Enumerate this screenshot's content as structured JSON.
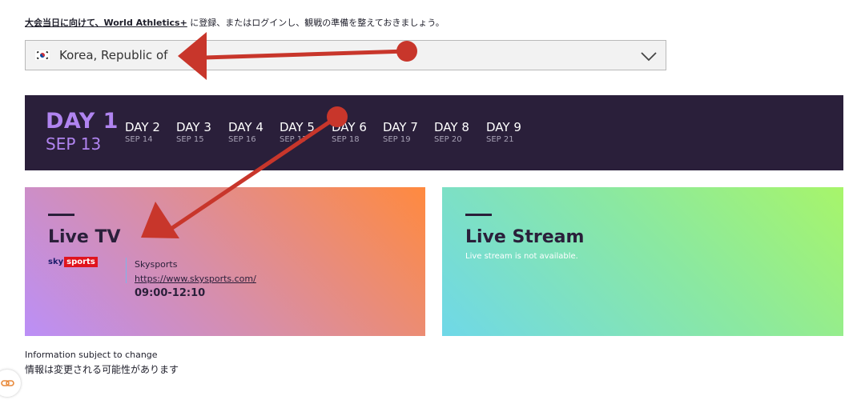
{
  "notice": {
    "link": "大会当日に向けて、World Athletics+",
    "rest": " に登録、またはログインし、観戦の準備を整えておきましょう。"
  },
  "country_select": {
    "selected": "Korea, Republic of",
    "flag_icon": "korea-flag-icon"
  },
  "days": {
    "active": {
      "day": "DAY 1",
      "date": "SEP 13"
    },
    "tabs": [
      {
        "day": "DAY 2",
        "date": "SEP 14"
      },
      {
        "day": "DAY 3",
        "date": "SEP 15"
      },
      {
        "day": "DAY 4",
        "date": "SEP 16"
      },
      {
        "day": "DAY 5",
        "date": "SEP 17"
      },
      {
        "day": "DAY 6",
        "date": "SEP 18"
      },
      {
        "day": "DAY 7",
        "date": "SEP 19"
      },
      {
        "day": "DAY 8",
        "date": "SEP 20"
      },
      {
        "day": "DAY 9",
        "date": "SEP 21"
      }
    ]
  },
  "live_tv": {
    "title": "Live TV",
    "logo_sky": "sky",
    "logo_sports": "sports",
    "broadcaster": "Skysports",
    "url": "https://www.skysports.com/",
    "time": "09:00-12:10"
  },
  "live_stream": {
    "title": "Live Stream",
    "note": "Live stream is not available."
  },
  "info": {
    "line1": "Information subject to change",
    "line2": "情報は変更される可能性があります"
  },
  "colors": {
    "day_bar": "#2a1f3a",
    "active_day": "#b084f0",
    "annotation_arrow": "#c8362b"
  }
}
